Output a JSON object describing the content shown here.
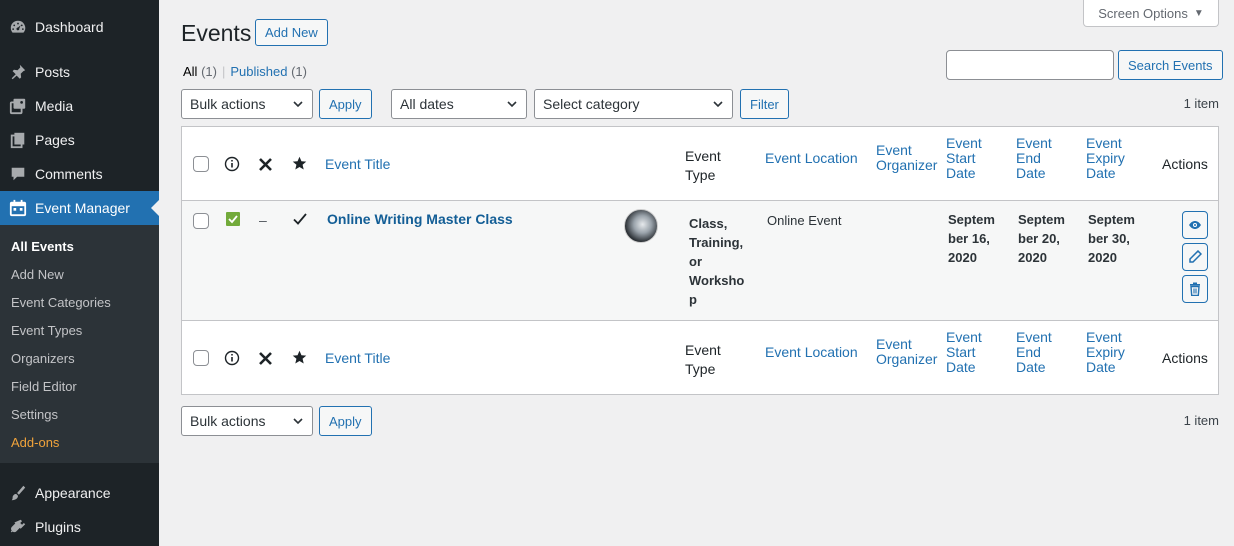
{
  "sidebar": {
    "top_items": [
      {
        "label": "Dashboard",
        "icon": "dashboard-icon"
      },
      {
        "label": "Posts",
        "icon": "pin-icon"
      },
      {
        "label": "Media",
        "icon": "media-icon"
      },
      {
        "label": "Pages",
        "icon": "pages-icon"
      },
      {
        "label": "Comments",
        "icon": "comment-icon"
      },
      {
        "label": "Event Manager",
        "icon": "calendar-icon"
      }
    ],
    "submenu": [
      "All Events",
      "Add New",
      "Event Categories",
      "Event Types",
      "Organizers",
      "Field Editor",
      "Settings",
      "Add-ons"
    ],
    "bottom_items": [
      {
        "label": "Appearance",
        "icon": "brush-icon"
      },
      {
        "label": "Plugins",
        "icon": "plugin-icon"
      }
    ]
  },
  "header": {
    "title": "Events",
    "add_new": "Add New",
    "screen_options": "Screen Options"
  },
  "views": {
    "all_label": "All",
    "all_count": "(1)",
    "sep": "|",
    "published_label": "Published",
    "published_count": "(1)"
  },
  "search": {
    "button": "Search Events",
    "value": ""
  },
  "filters": {
    "bulk_actions": "Bulk actions",
    "apply": "Apply",
    "dates": "All dates",
    "category": "Select category",
    "filter": "Filter",
    "count": "1 item"
  },
  "table": {
    "columns": {
      "title": "Event Title",
      "type_1": "Event",
      "type_2": "Type",
      "location": "Event Location",
      "organizer_1": "Event",
      "organizer_2": "Organizer",
      "start_1": "Event",
      "start_2": "Start",
      "start_3": "Date",
      "end_1": "Event",
      "end_2": "End",
      "end_3": "Date",
      "expiry_1": "Event",
      "expiry_2": "Expiry",
      "expiry_3": "Date",
      "actions": "Actions"
    },
    "row": {
      "dash": "–",
      "title": "Online Writing Master Class",
      "type_lines": [
        "Class,",
        "Training,",
        "or",
        "Worksho",
        "p"
      ],
      "location": "Online Event",
      "start_lines": [
        "Septem",
        "ber 16,",
        "2020"
      ],
      "end_lines": [
        "Septem",
        "ber 20,",
        "2020"
      ],
      "expiry_lines": [
        "Septem",
        "ber 30,",
        "2020"
      ]
    }
  },
  "colors": {
    "accent": "#2271b1",
    "sidebar": "#1d2327",
    "active_menu": "#2271b1",
    "addons": "#f0a33b",
    "check_green": "#72aa3a"
  }
}
